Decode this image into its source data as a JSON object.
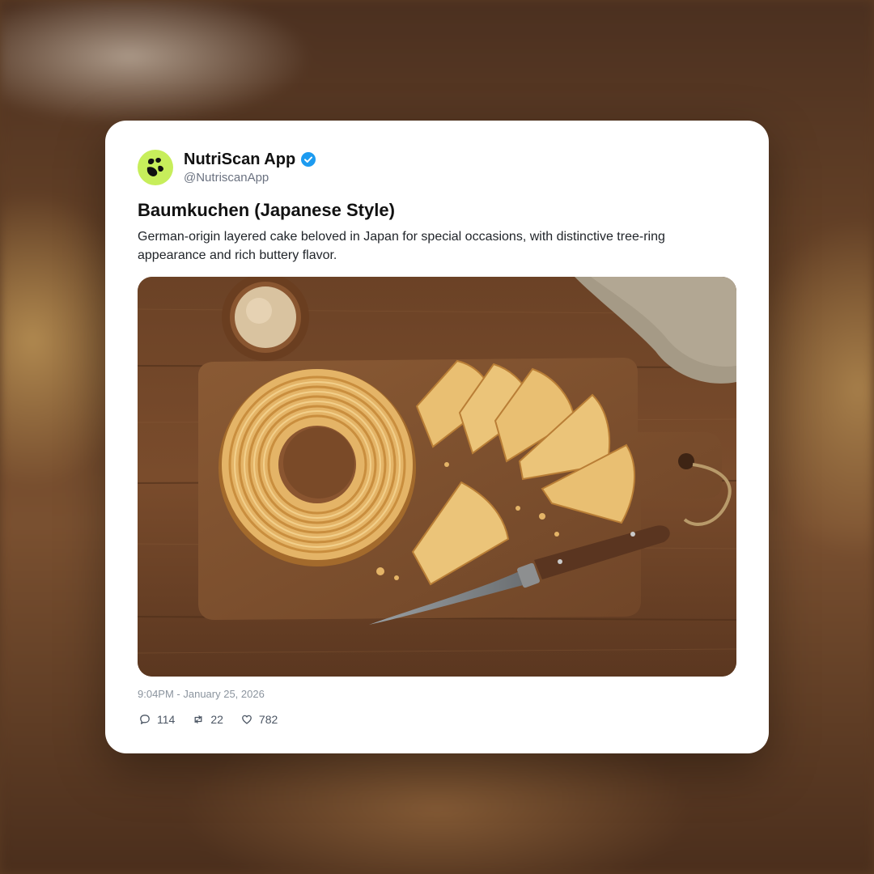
{
  "post": {
    "author_name": "NutriScan App",
    "author_handle": "@NutriscanApp",
    "avatar_icon": "leaf-logo-icon",
    "verified_icon": "verified-badge-icon",
    "brand_color": "#c7ee5b",
    "verified_color": "#1d9bf0",
    "title": "Baumkuchen (Japanese Style)",
    "description": "German-origin layered cake beloved in Japan for special occasions, with distinctive tree-ring appearance and rich buttery flavor.",
    "timestamp": "9:04PM - January 25, 2026",
    "stats": {
      "replies": "114",
      "reposts": "22",
      "likes": "782"
    }
  }
}
